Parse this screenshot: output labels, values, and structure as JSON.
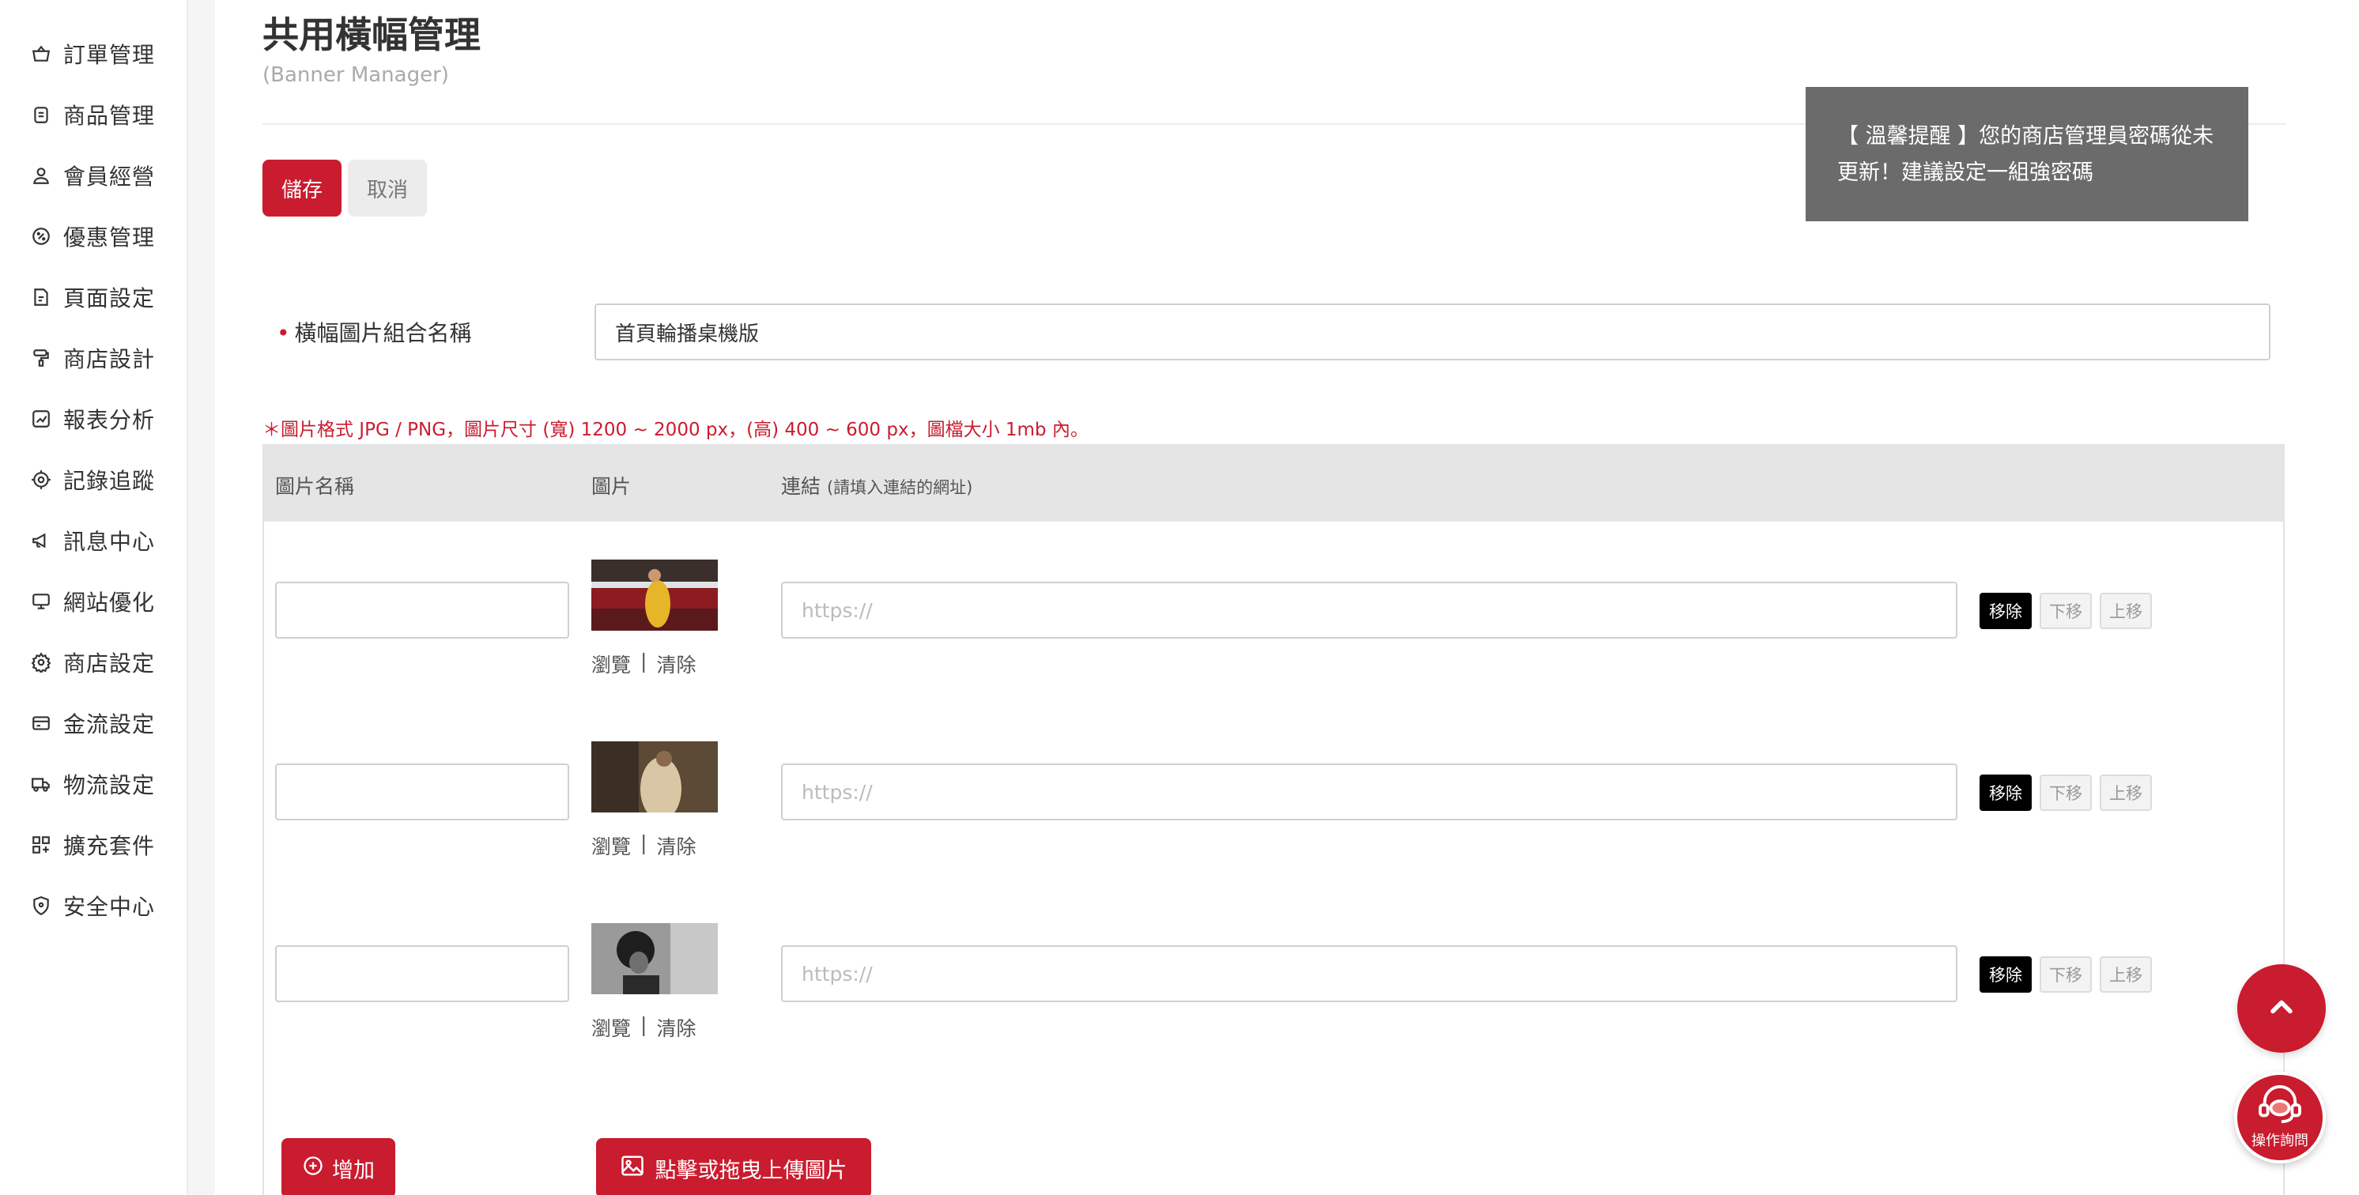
{
  "sidebar": {
    "items": [
      {
        "label": "訂單管理",
        "icon": "basket-icon"
      },
      {
        "label": "商品管理",
        "icon": "clipboard-icon"
      },
      {
        "label": "會員經營",
        "icon": "user-icon"
      },
      {
        "label": "優惠管理",
        "icon": "discount-badge-icon"
      },
      {
        "label": "頁面設定",
        "icon": "page-icon"
      },
      {
        "label": "商店設計",
        "icon": "paint-roller-icon"
      },
      {
        "label": "報表分析",
        "icon": "chart-icon"
      },
      {
        "label": "記錄追蹤",
        "icon": "target-icon"
      },
      {
        "label": "訊息中心",
        "icon": "megaphone-icon"
      },
      {
        "label": "網站優化",
        "icon": "monitor-icon"
      },
      {
        "label": "商店設定",
        "icon": "gear-icon"
      },
      {
        "label": "金流設定",
        "icon": "credit-card-icon"
      },
      {
        "label": "物流設定",
        "icon": "truck-icon"
      },
      {
        "label": "擴充套件",
        "icon": "grid-plus-icon"
      },
      {
        "label": "安全中心",
        "icon": "shield-icon"
      }
    ]
  },
  "header": {
    "title": "共用橫幅管理",
    "subtitle": "(Banner Manager)"
  },
  "actions": {
    "save_label": "儲存",
    "cancel_label": "取消"
  },
  "form": {
    "group_name_label": "橫幅圖片組合名稱",
    "group_name_value": "首頁輪播桌機版",
    "hint": "＊圖片格式 JPG / PNG，圖片尺寸 (寬) 1200 ~ 2000 px，(高) 400 ~ 600 px，圖檔大小 1mb 內。"
  },
  "table": {
    "headers": {
      "name": "圖片名稱",
      "image": "圖片",
      "link": "連結",
      "link_note": "(請填入連結的網址)"
    },
    "rows": [
      {
        "name": "",
        "link": "",
        "link_placeholder": "https://",
        "browse": "瀏覽",
        "sep": "|",
        "clear": "清除",
        "remove": "移除",
        "down": "下移",
        "up": "上移"
      },
      {
        "name": "",
        "link": "",
        "link_placeholder": "https://",
        "browse": "瀏覽",
        "sep": "|",
        "clear": "清除",
        "remove": "移除",
        "down": "下移",
        "up": "上移"
      },
      {
        "name": "",
        "link": "",
        "link_placeholder": "https://",
        "browse": "瀏覽",
        "sep": "|",
        "clear": "清除",
        "remove": "移除",
        "down": "下移",
        "up": "上移"
      }
    ],
    "add_label": "增加",
    "upload_label": "點擊或拖曳上傳圖片"
  },
  "toast": {
    "message": "【 溫馨提醒 】您的商店管理員密碼從未更新！建議設定一組強密碼"
  },
  "floating": {
    "help_label": "操作詢問"
  },
  "colors": {
    "brand": "#c91c2f",
    "toast_bg": "#6b6b6b",
    "header_bg": "#e5e5e5"
  }
}
